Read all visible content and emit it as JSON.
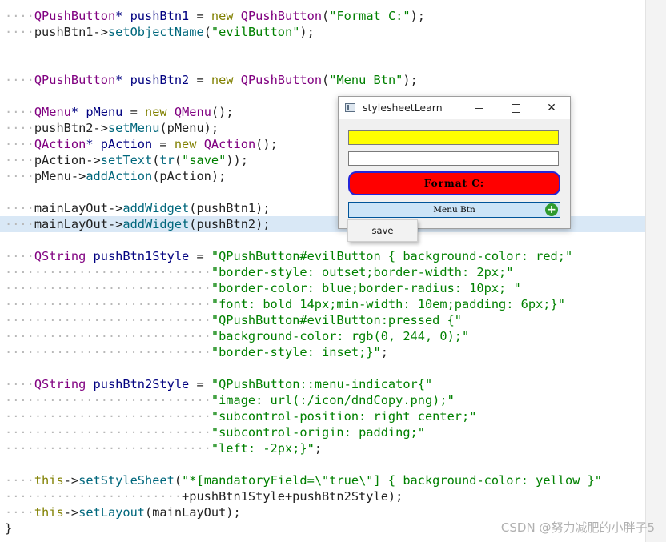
{
  "code_lines": [
    {
      "indent": 1,
      "tokens": [
        {
          "t": "QPushButton",
          "c": "ty"
        },
        {
          "t": "* ",
          "c": "ob"
        },
        {
          "t": "pushBtn1 ",
          "c": "ob"
        },
        {
          "t": "= ",
          "c": ""
        },
        {
          "t": "new ",
          "c": "kw"
        },
        {
          "t": "QPushButton",
          "c": "ty"
        },
        {
          "t": "(",
          "c": ""
        },
        {
          "t": "\"Format C:\"",
          "c": "st"
        },
        {
          "t": ");",
          "c": ""
        }
      ]
    },
    {
      "indent": 1,
      "tokens": [
        {
          "t": "pushBtn1->",
          "c": ""
        },
        {
          "t": "setObjectName",
          "c": "fn"
        },
        {
          "t": "(",
          "c": ""
        },
        {
          "t": "\"evilButton\"",
          "c": "st"
        },
        {
          "t": ");",
          "c": ""
        }
      ]
    },
    {
      "indent": 0,
      "tokens": []
    },
    {
      "indent": 0,
      "tokens": []
    },
    {
      "indent": 1,
      "tokens": [
        {
          "t": "QPushButton",
          "c": "ty"
        },
        {
          "t": "* ",
          "c": "ob"
        },
        {
          "t": "pushBtn2 ",
          "c": "ob"
        },
        {
          "t": "= ",
          "c": ""
        },
        {
          "t": "new ",
          "c": "kw"
        },
        {
          "t": "QPushButton",
          "c": "ty"
        },
        {
          "t": "(",
          "c": ""
        },
        {
          "t": "\"Menu Btn\"",
          "c": "st"
        },
        {
          "t": ");",
          "c": ""
        }
      ]
    },
    {
      "indent": 0,
      "tokens": []
    },
    {
      "indent": 1,
      "tokens": [
        {
          "t": "QMenu",
          "c": "ty"
        },
        {
          "t": "* ",
          "c": "ob"
        },
        {
          "t": "pMenu ",
          "c": "ob"
        },
        {
          "t": "= ",
          "c": ""
        },
        {
          "t": "new ",
          "c": "kw"
        },
        {
          "t": "QMenu",
          "c": "ty"
        },
        {
          "t": "();",
          "c": ""
        }
      ]
    },
    {
      "indent": 1,
      "tokens": [
        {
          "t": "pushBtn2->",
          "c": ""
        },
        {
          "t": "setMenu",
          "c": "fn"
        },
        {
          "t": "(pMenu);",
          "c": ""
        }
      ]
    },
    {
      "indent": 1,
      "tokens": [
        {
          "t": "QAction",
          "c": "ty"
        },
        {
          "t": "* ",
          "c": "ob"
        },
        {
          "t": "pAction ",
          "c": "ob"
        },
        {
          "t": "= ",
          "c": ""
        },
        {
          "t": "new ",
          "c": "kw"
        },
        {
          "t": "QAction",
          "c": "ty"
        },
        {
          "t": "();",
          "c": ""
        }
      ]
    },
    {
      "indent": 1,
      "tokens": [
        {
          "t": "pAction->",
          "c": ""
        },
        {
          "t": "setText",
          "c": "fn"
        },
        {
          "t": "(",
          "c": ""
        },
        {
          "t": "tr",
          "c": "fn"
        },
        {
          "t": "(",
          "c": ""
        },
        {
          "t": "\"save\"",
          "c": "st"
        },
        {
          "t": "));",
          "c": ""
        }
      ]
    },
    {
      "indent": 1,
      "tokens": [
        {
          "t": "pMenu->",
          "c": ""
        },
        {
          "t": "addAction",
          "c": "fn"
        },
        {
          "t": "(pAction);",
          "c": ""
        }
      ]
    },
    {
      "indent": 0,
      "tokens": []
    },
    {
      "indent": 1,
      "tokens": [
        {
          "t": "mainLayOut->",
          "c": ""
        },
        {
          "t": "addWidget",
          "c": "fn"
        },
        {
          "t": "(pushBtn1);",
          "c": ""
        }
      ]
    },
    {
      "indent": 1,
      "tokens": [
        {
          "t": "mainLayOut->",
          "c": ""
        },
        {
          "t": "addWidget",
          "c": "fn"
        },
        {
          "t": "(pushBtn2);",
          "c": ""
        }
      ]
    },
    {
      "indent": 0,
      "tokens": []
    },
    {
      "indent": 1,
      "tokens": [
        {
          "t": "QString ",
          "c": "ty"
        },
        {
          "t": "pushBtn1Style ",
          "c": "ob"
        },
        {
          "t": "= ",
          "c": ""
        },
        {
          "t": "\"QPushButton#evilButton { background-color: red;\"",
          "c": "st"
        }
      ]
    },
    {
      "indent": 7,
      "tokens": [
        {
          "t": "\"border-style: outset;border-width: 2px;\"",
          "c": "st"
        }
      ]
    },
    {
      "indent": 7,
      "tokens": [
        {
          "t": "\"border-color: blue;border-radius: 10px; \"",
          "c": "st"
        }
      ]
    },
    {
      "indent": 7,
      "tokens": [
        {
          "t": "\"font: bold 14px;min-width: 10em;padding: 6px;}\"",
          "c": "st"
        }
      ]
    },
    {
      "indent": 7,
      "tokens": [
        {
          "t": "\"QPushButton#evilButton:pressed {\"",
          "c": "st"
        }
      ]
    },
    {
      "indent": 7,
      "tokens": [
        {
          "t": "\"background-color: rgb(0, 244, 0);\"",
          "c": "st"
        }
      ]
    },
    {
      "indent": 7,
      "tokens": [
        {
          "t": "\"border-style: inset;}\"",
          "c": "st"
        },
        {
          "t": ";",
          "c": ""
        }
      ]
    },
    {
      "indent": 0,
      "tokens": []
    },
    {
      "indent": 1,
      "tokens": [
        {
          "t": "QString ",
          "c": "ty"
        },
        {
          "t": "pushBtn2Style ",
          "c": "ob"
        },
        {
          "t": "= ",
          "c": ""
        },
        {
          "t": "\"QPushButton::menu-indicator{\"",
          "c": "st"
        }
      ]
    },
    {
      "indent": 7,
      "tokens": [
        {
          "t": "\"image: url(:/icon/dndCopy.png);\"",
          "c": "st"
        }
      ]
    },
    {
      "indent": 7,
      "tokens": [
        {
          "t": "\"subcontrol-position: right center;\"",
          "c": "st"
        }
      ]
    },
    {
      "indent": 7,
      "tokens": [
        {
          "t": "\"subcontrol-origin: padding;\"",
          "c": "st"
        }
      ]
    },
    {
      "indent": 7,
      "tokens": [
        {
          "t": "\"left: -2px;}\"",
          "c": "st"
        },
        {
          "t": ";",
          "c": ""
        }
      ]
    },
    {
      "indent": 0,
      "tokens": []
    },
    {
      "indent": 1,
      "tokens": [
        {
          "t": "this",
          "c": "kw"
        },
        {
          "t": "->",
          "c": ""
        },
        {
          "t": "setStyleSheet",
          "c": "fn"
        },
        {
          "t": "(",
          "c": ""
        },
        {
          "t": "\"*[mandatoryField=\\\"true\\\"] { background-color: yellow }\"",
          "c": "st"
        }
      ]
    },
    {
      "indent": 6,
      "tokens": [
        {
          "t": "+pushBtn1Style+pushBtn2Style);",
          "c": ""
        }
      ]
    },
    {
      "indent": 1,
      "tokens": [
        {
          "t": "this",
          "c": "kw"
        },
        {
          "t": "->",
          "c": ""
        },
        {
          "t": "setLayout",
          "c": "fn"
        },
        {
          "t": "(mainLayOut);",
          "c": ""
        }
      ]
    },
    {
      "indent": 0,
      "tokens": [
        {
          "t": "}",
          "c": ""
        }
      ]
    }
  ],
  "highlighted_line": 13,
  "window": {
    "title": "stylesheetLearn",
    "minimize_glyph": "—",
    "maximize_glyph": "☐",
    "close_glyph": "✕",
    "evil_button_label": "Format C:",
    "menu_button_label": "Menu Btn",
    "menu_indicator_glyph": "+",
    "menu_item_save": "save"
  },
  "watermark": "CSDN @努力减肥的小胖子5",
  "colors": {
    "type": "#800080",
    "keyword": "#808000",
    "function": "#00677c",
    "string": "#008000",
    "highlight": "#d9e8f6",
    "evil_bg": "#ff0000",
    "evil_border": "#2525d8",
    "mandatory_bg": "#ffff00"
  }
}
